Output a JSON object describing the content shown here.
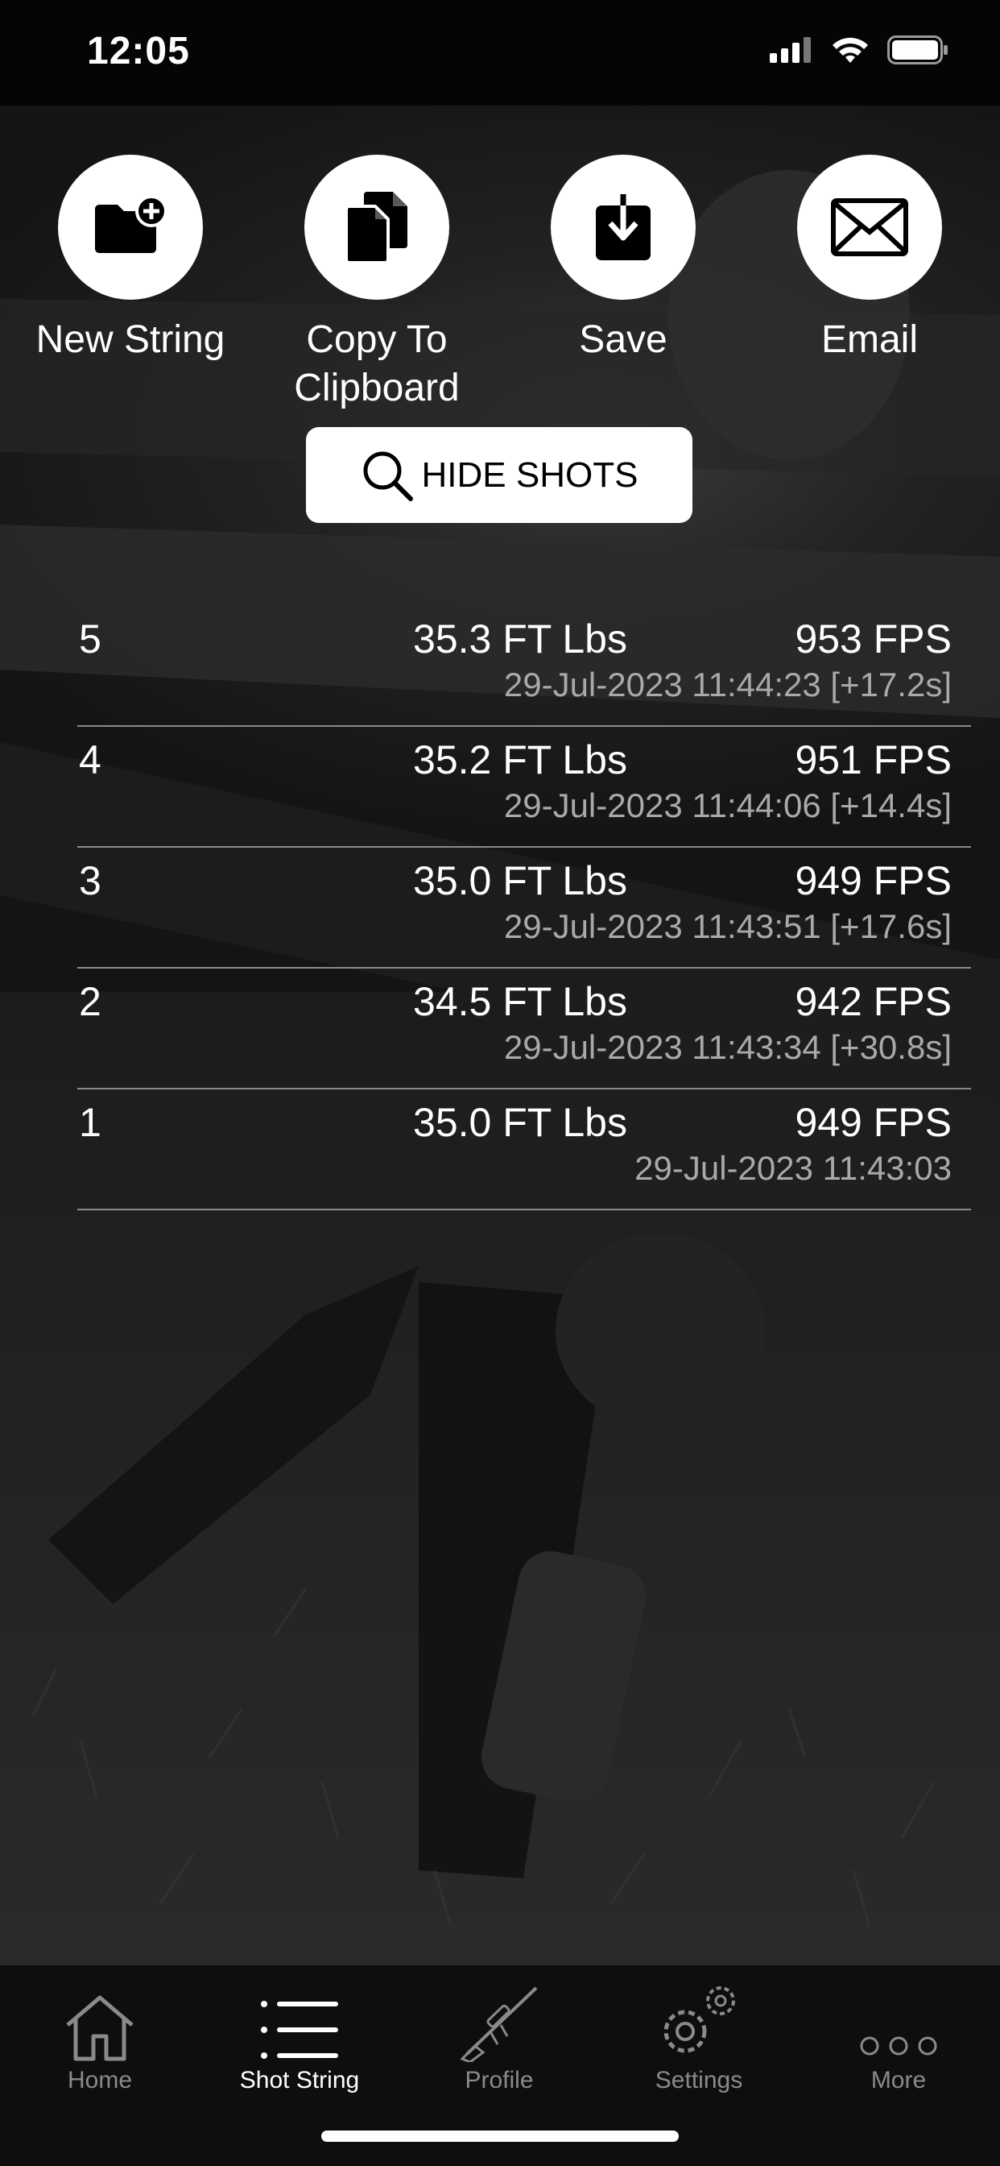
{
  "status_bar": {
    "time": "12:05",
    "icons": [
      "cellular-signal-icon",
      "wifi-icon",
      "battery-icon"
    ]
  },
  "actions": [
    {
      "label": "New String",
      "icon": "folder-plus-icon"
    },
    {
      "label": "Copy To\nClipboard",
      "icon": "copy-documents-icon"
    },
    {
      "label": "Save",
      "icon": "download-icon"
    },
    {
      "label": "Email",
      "icon": "envelope-icon"
    }
  ],
  "hide_shots": {
    "label": "HIDE SHOTS",
    "icon": "magnifier-icon"
  },
  "shots": [
    {
      "number": "5",
      "energy": "35.3 FT Lbs",
      "velocity": "953 FPS",
      "timestamp": "29-Jul-2023 11:44:23 [+17.2s]"
    },
    {
      "number": "4",
      "energy": "35.2 FT Lbs",
      "velocity": "951 FPS",
      "timestamp": "29-Jul-2023 11:44:06 [+14.4s]"
    },
    {
      "number": "3",
      "energy": "35.0 FT Lbs",
      "velocity": "949 FPS",
      "timestamp": "29-Jul-2023 11:43:51 [+17.6s]"
    },
    {
      "number": "2",
      "energy": "34.5 FT Lbs",
      "velocity": "942 FPS",
      "timestamp": "29-Jul-2023 11:43:34 [+30.8s]"
    },
    {
      "number": "1",
      "energy": "35.0 FT Lbs",
      "velocity": "949 FPS",
      "timestamp": "29-Jul-2023 11:43:03"
    }
  ],
  "tab_bar": {
    "tabs": [
      {
        "label": "Home",
        "icon": "home-icon",
        "active": false
      },
      {
        "label": "Shot String",
        "icon": "list-icon",
        "active": true
      },
      {
        "label": "Profile",
        "icon": "rifle-icon",
        "active": false
      },
      {
        "label": "Settings",
        "icon": "gears-icon",
        "active": false
      },
      {
        "label": "More",
        "icon": "more-dots-icon",
        "active": false
      }
    ]
  },
  "colors": {
    "background": "#000000",
    "text_primary": "#ffffff",
    "text_secondary": "#a9a9a9",
    "tab_inactive": "#8a8a8a",
    "button_fill": "#ffffff"
  }
}
